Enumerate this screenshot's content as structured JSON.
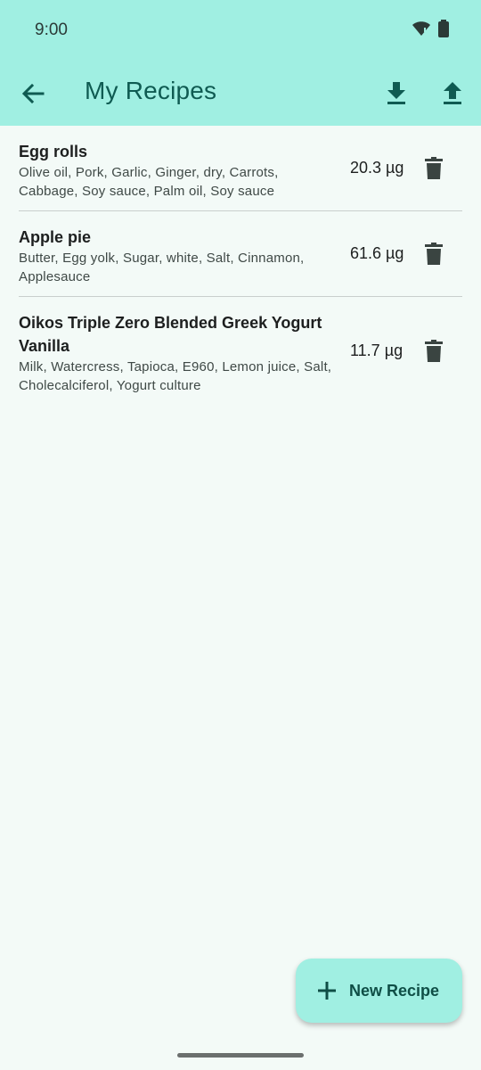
{
  "status": {
    "time": "9:00",
    "icons": [
      "wifi-alert-icon",
      "battery-icon"
    ]
  },
  "appbar": {
    "title": "My Recipes",
    "back_icon": "arrow-back-icon",
    "actions": [
      "download-icon",
      "upload-icon"
    ]
  },
  "recipes": [
    {
      "title": "Egg rolls",
      "ingredients": "Olive oil, Pork, Garlic, Ginger, dry, Carrots, Cabbage, Soy sauce, Palm oil, Soy sauce",
      "value": "20.3 µg"
    },
    {
      "title": "Apple pie",
      "ingredients": "Butter, Egg yolk, Sugar, white, Salt, Cinnamon, Applesauce",
      "value": "61.6 µg"
    },
    {
      "title": "Oikos Triple Zero Blended Greek Yogurt Vanilla",
      "ingredients": "Milk, Watercress, Tapioca, E960, Lemon juice, Salt, Cholecalciferol, Yogurt culture",
      "value": "11.7 µg"
    }
  ],
  "fab": {
    "label": "New Recipe",
    "icon": "plus-icon"
  },
  "colors": {
    "appbar_bg": "#a0efe2",
    "page_bg": "#f3faf7",
    "title_color": "#0f5b52",
    "icon_dark": "#3a4441"
  }
}
